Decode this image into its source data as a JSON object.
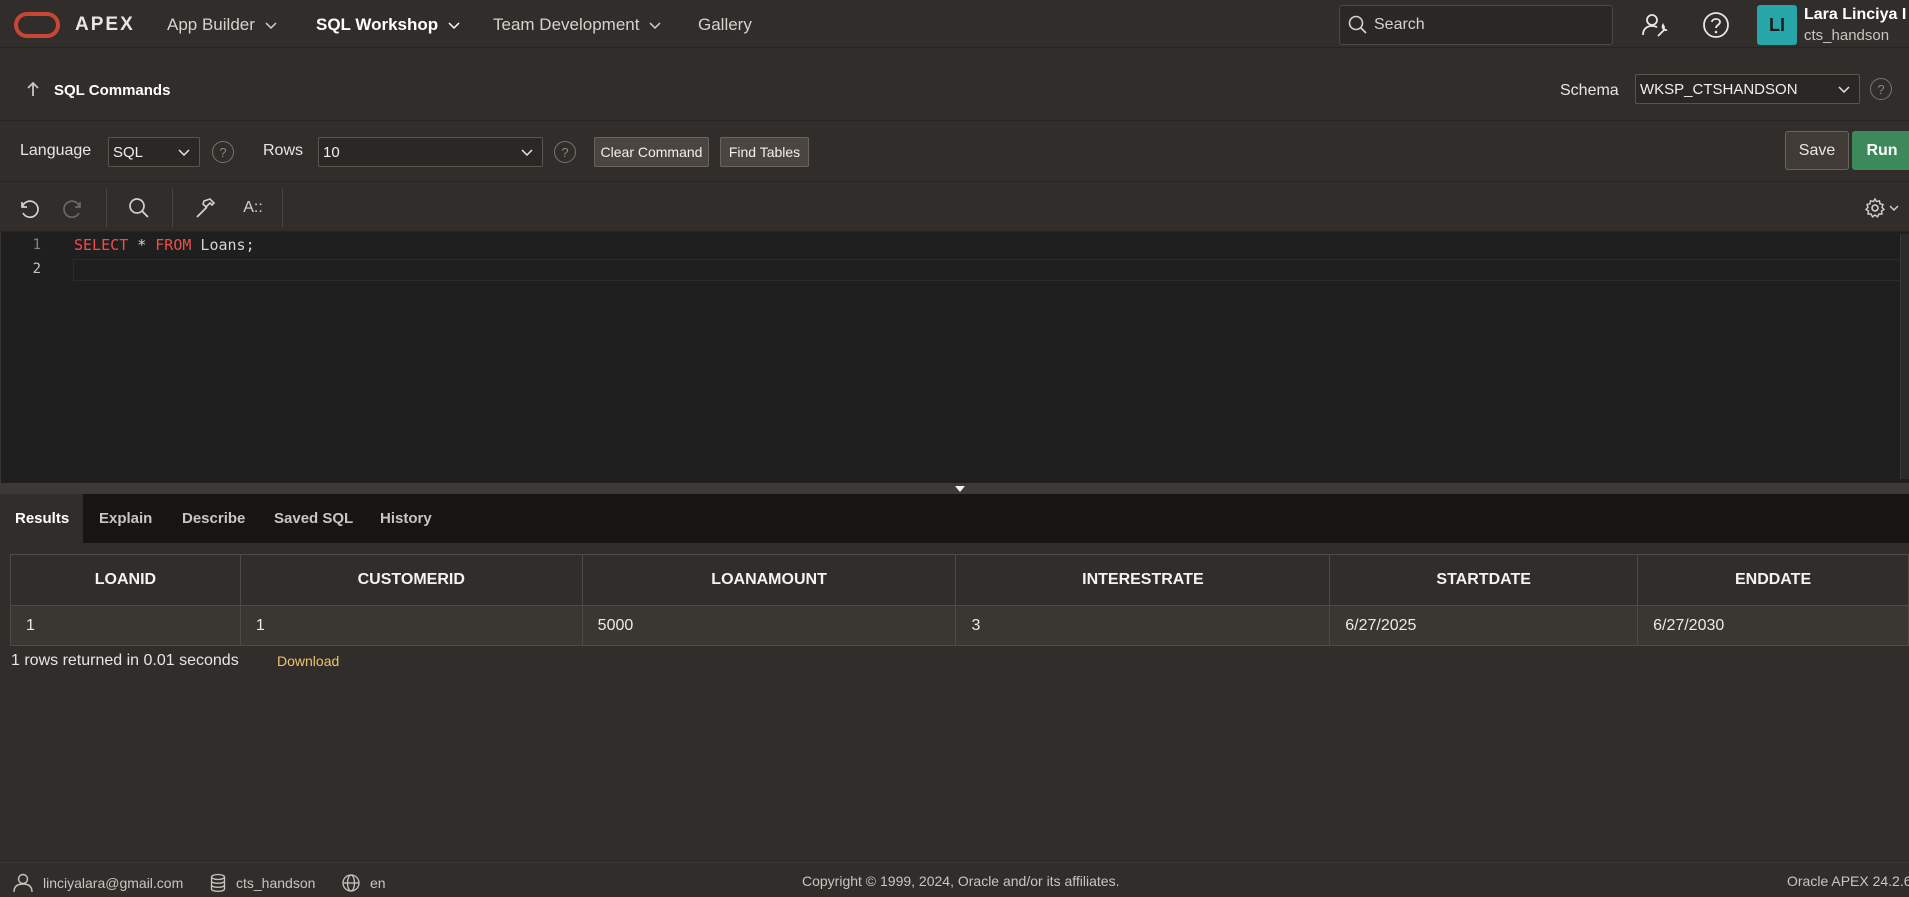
{
  "nav": {
    "brand": "APEX",
    "items": [
      {
        "label": "App Builder"
      },
      {
        "label": "SQL Workshop"
      },
      {
        "label": "Team Development"
      },
      {
        "label": "Gallery"
      }
    ],
    "search_placeholder": "Search",
    "user": {
      "initials": "LI",
      "name": "Lara Linciya I",
      "workspace": "cts_handson"
    }
  },
  "title_bar": {
    "title": "SQL Commands",
    "schema_label": "Schema",
    "schema_value": "WKSP_CTSHANDSON"
  },
  "toolbar": {
    "language_label": "Language",
    "language_value": "SQL",
    "rows_label": "Rows",
    "rows_value": "10",
    "clear_command": "Clear Command",
    "find_tables": "Find Tables",
    "save": "Save",
    "run": "Run",
    "help_glyph": "?",
    "format_label": "A::"
  },
  "editor": {
    "line_numbers": [
      "1",
      "2"
    ],
    "line1": {
      "kw1": "SELECT",
      "mid": " * ",
      "kw2": "FROM",
      "rest": " Loans;"
    },
    "line2": ""
  },
  "tabs": [
    {
      "label": "Results",
      "active": true
    },
    {
      "label": "Explain"
    },
    {
      "label": "Describe"
    },
    {
      "label": "Saved SQL"
    },
    {
      "label": "History"
    }
  ],
  "results": {
    "columns": [
      "LOANID",
      "CUSTOMERID",
      "LOANAMOUNT",
      "INTERESTRATE",
      "STARTDATE",
      "ENDDATE"
    ],
    "rows": [
      [
        "1",
        "1",
        "5000",
        "3",
        "6/27/2025",
        "6/27/2030"
      ]
    ],
    "summary": "1 rows returned in 0.01 seconds",
    "download": "Download"
  },
  "footer": {
    "email": "linciyalara@gmail.com",
    "workspace": "cts_handson",
    "language": "en",
    "copyright": "Copyright © 1999, 2024, Oracle and/or its affiliates.",
    "version": "Oracle APEX 24.2.6"
  },
  "colors": {
    "brand_red": "#c74634",
    "run_green": "#3c8a5c",
    "avatar_teal": "#27a5a8",
    "download_link": "#f0c26b",
    "sql_keyword": "#f14c4c"
  }
}
